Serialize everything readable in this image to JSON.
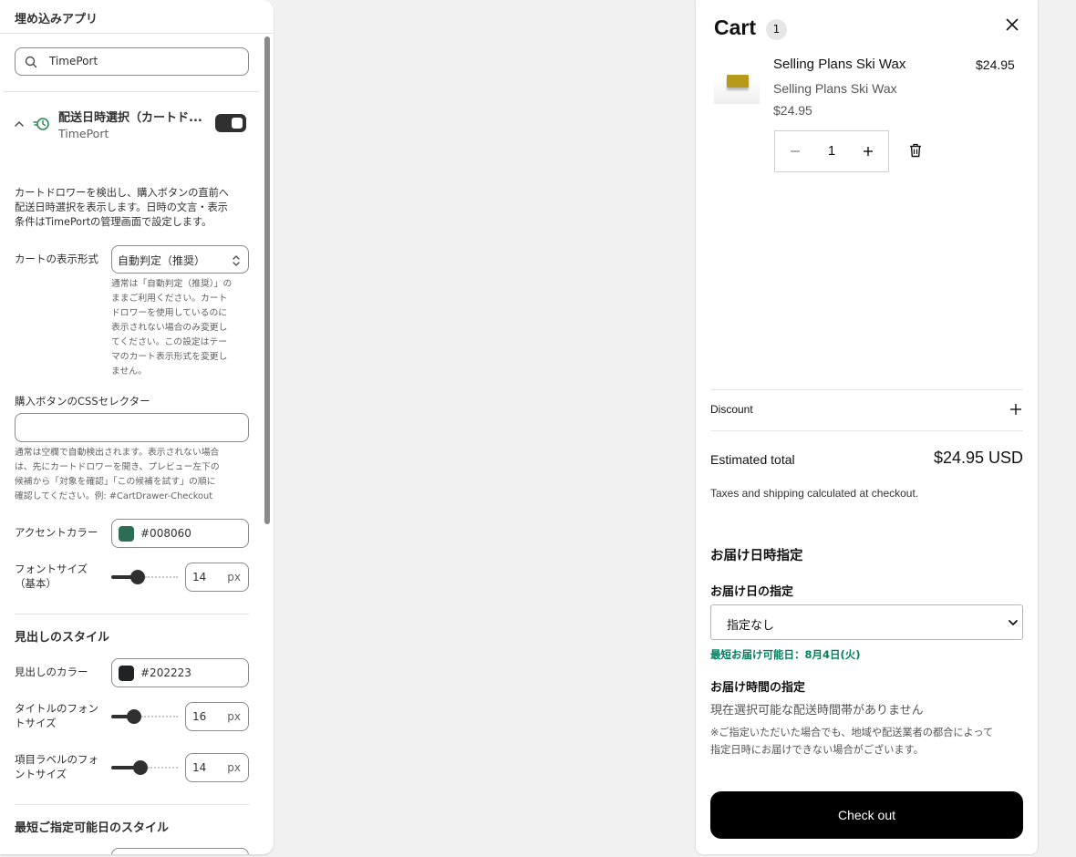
{
  "editor": {
    "header_title": "埋め込みアプリ",
    "search": {
      "value": "TimePort",
      "icon": "search-icon"
    },
    "block": {
      "title": "配送日時選択（カートド...",
      "subtitle": "TimePort",
      "enabled": true
    },
    "description": [
      "カートドロワーを検出し、購入ボタンの直前へ",
      "配送日時選択を表示します。日時の文言・表示",
      "条件はTimePortの管理画面で設定します。"
    ],
    "cart_display": {
      "label": "カートの表示形式",
      "value": "自動判定（推奨）",
      "help": [
        "通常は「自動判定（推奨）」の",
        "ままご利用ください。カート",
        "ドロワーを使用しているのに",
        "表示されない場合のみ変更し",
        "てください。この設定はテー",
        "マのカート表示形式を変更し",
        "ません。"
      ]
    },
    "css_selector": {
      "label": "購入ボタンのCSSセレクター",
      "value": "",
      "help": [
        "通常は空欄で自動検出されます。表示されない場合",
        "は、先にカートドロワーを開き、プレビュー左下の",
        "候補から「対象を確認」「この候補を試す」の順に",
        "確認してください。例: #CartDrawer-Checkout"
      ]
    },
    "accent_color": {
      "label": "アクセントカラー",
      "value": "#008060",
      "swatch": "#2b6e55"
    },
    "font_size": {
      "label": [
        "フォントサイズ",
        "（基本）"
      ],
      "value": "14",
      "unit": "px",
      "level": 0.37
    },
    "heading_section": {
      "title": "見出しのスタイル",
      "color": {
        "label": "見出しのカラー",
        "value": "#202223",
        "swatch": "#202223"
      },
      "title_font": {
        "label": [
          "タイトルのフォン",
          "トサイズ"
        ],
        "value": "16",
        "unit": "px",
        "level": 0.3
      },
      "item_font": {
        "label": [
          "項目ラベルのフォ",
          "ントサイズ"
        ],
        "value": "14",
        "unit": "px",
        "level": 0.42
      }
    },
    "earliest_section": {
      "title": "最短ご指定可能日のスタイル"
    }
  },
  "cart": {
    "title": "Cart",
    "count": "1",
    "item": {
      "name": "Selling Plans Ski Wax",
      "price": "$24.95",
      "variant": "Selling Plans Ski Wax",
      "unit_price": "$24.95",
      "quantity": "1"
    },
    "discount_label": "Discount",
    "estimated_total_label": "Estimated total",
    "estimated_total_value": "$24.95 USD",
    "taxes_note": "Taxes and shipping calculated at checkout.",
    "delivery": {
      "title": "お届け日時指定",
      "date_label": "お届け日の指定",
      "date_value": "指定なし",
      "earliest": "最短お届け可能日：8月4日(火)",
      "time_label": "お届け時間の指定",
      "time_none": "現在選択可能な配送時間帯がありません",
      "notice": [
        "※ご指定いただいた場合でも、地域や配送業者の都合によって",
        "指定日時にお届けできない場合がございます。"
      ]
    },
    "checkout_label": "Check out"
  },
  "colors": {
    "accent": "#008060",
    "checkout": "#000000",
    "toggle": "#303030"
  }
}
